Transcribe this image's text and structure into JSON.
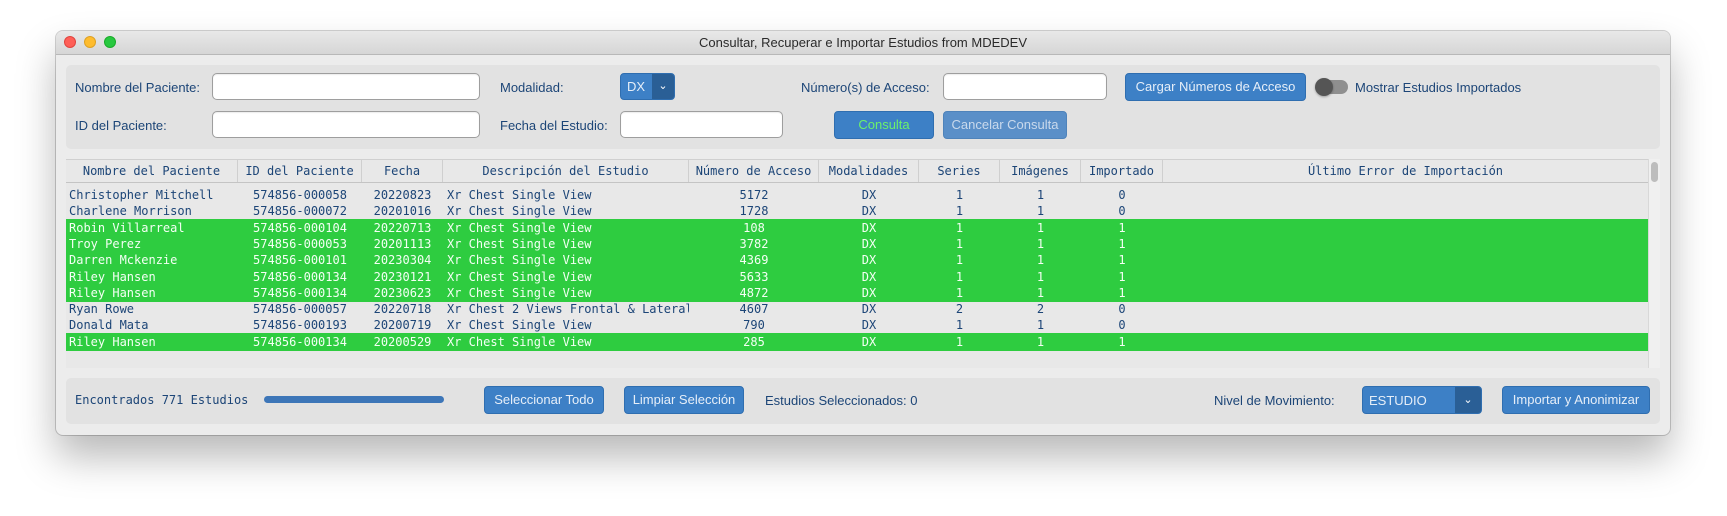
{
  "window": {
    "title": "Consultar, Recuperar e Importar Estudios from MDEDEV"
  },
  "search": {
    "patient_name_label": "Nombre del Paciente:",
    "patient_name_value": "",
    "patient_id_label": "ID del Paciente:",
    "patient_id_value": "",
    "modality_label": "Modalidad:",
    "modality_value": "DX",
    "study_date_label": "Fecha del Estudio:",
    "study_date_value": "",
    "accession_label": "Número(s) de Acceso:",
    "accession_value": "",
    "load_accession_button": "Cargar Números de Acceso",
    "show_imported_label": "Mostrar Estudios Importados",
    "query_button": "Consulta",
    "cancel_query_button": "Cancelar Consulta"
  },
  "table": {
    "columns": [
      "Nombre del Paciente",
      "ID del Paciente",
      "Fecha",
      "Descripción del Estudio",
      "Número de Acceso",
      "Modalidades",
      "Series",
      "Imágenes",
      "Importado",
      "Último Error de Importación"
    ],
    "rows": [
      {
        "name": "Christopher Mitchell",
        "id": "574856-000058",
        "date": "20220823",
        "desc": "Xr Chest Single View",
        "acc": "5172",
        "mod": "DX",
        "series": "1",
        "images": "1",
        "imported": "0",
        "error": ""
      },
      {
        "name": "Charlene Morrison",
        "id": "574856-000072",
        "date": "20201016",
        "desc": "Xr Chest Single View",
        "acc": "1728",
        "mod": "DX",
        "series": "1",
        "images": "1",
        "imported": "0",
        "error": ""
      },
      {
        "name": "Robin Villarreal",
        "id": "574856-000104",
        "date": "20220713",
        "desc": "Xr Chest Single View",
        "acc": "108",
        "mod": "DX",
        "series": "1",
        "images": "1",
        "imported": "1",
        "error": ""
      },
      {
        "name": "Troy Perez",
        "id": "574856-000053",
        "date": "20201113",
        "desc": "Xr Chest Single View",
        "acc": "3782",
        "mod": "DX",
        "series": "1",
        "images": "1",
        "imported": "1",
        "error": ""
      },
      {
        "name": "Darren Mckenzie",
        "id": "574856-000101",
        "date": "20230304",
        "desc": "Xr Chest Single View",
        "acc": "4369",
        "mod": "DX",
        "series": "1",
        "images": "1",
        "imported": "1",
        "error": ""
      },
      {
        "name": "Riley Hansen",
        "id": "574856-000134",
        "date": "20230121",
        "desc": "Xr Chest Single View",
        "acc": "5633",
        "mod": "DX",
        "series": "1",
        "images": "1",
        "imported": "1",
        "error": ""
      },
      {
        "name": "Riley Hansen",
        "id": "574856-000134",
        "date": "20230623",
        "desc": "Xr Chest Single View",
        "acc": "4872",
        "mod": "DX",
        "series": "1",
        "images": "1",
        "imported": "1",
        "error": ""
      },
      {
        "name": "Ryan Rowe",
        "id": "574856-000057",
        "date": "20220718",
        "desc": "Xr Chest 2 Views Frontal & Lateral",
        "acc": "4607",
        "mod": "DX",
        "series": "2",
        "images": "2",
        "imported": "0",
        "error": ""
      },
      {
        "name": "Donald Mata",
        "id": "574856-000193",
        "date": "20200719",
        "desc": "Xr Chest Single View",
        "acc": "790",
        "mod": "DX",
        "series": "1",
        "images": "1",
        "imported": "0",
        "error": ""
      },
      {
        "name": "Riley Hansen",
        "id": "574856-000134",
        "date": "20200529",
        "desc": "Xr Chest Single View",
        "acc": "285",
        "mod": "DX",
        "series": "1",
        "images": "1",
        "imported": "1",
        "error": ""
      }
    ]
  },
  "footer": {
    "found_label": "Encontrados 771 Estudios",
    "progress": 1.0,
    "select_all_button": "Seleccionar Todo",
    "clear_selection_button": "Limpiar Selección",
    "selected_label": "Estudios Seleccionados: 0",
    "movement_level_label": "Nivel de Movimiento:",
    "movement_level_value": "ESTUDIO",
    "import_button": "Importar y Anonimizar"
  },
  "colors": {
    "imported_row": "#2ecc40",
    "accent": "#3d80c6",
    "text": "#1c4577"
  }
}
